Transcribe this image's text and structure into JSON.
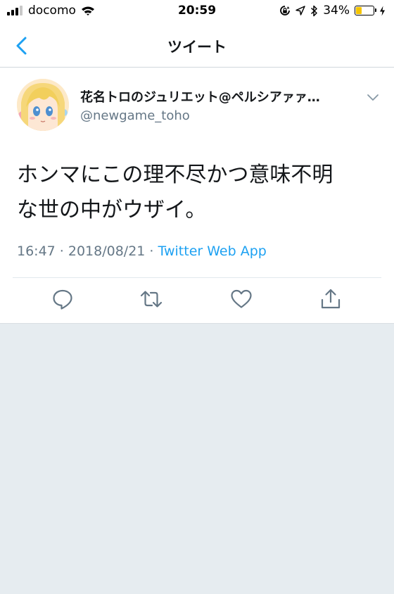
{
  "status_bar": {
    "carrier": "docomo",
    "time": "20:59",
    "battery_percent": "34%",
    "battery_level": 0.34,
    "icons": [
      "signal-icon",
      "wifi-icon",
      "screen-lock-icon",
      "location-icon",
      "bluetooth-icon",
      "battery-icon",
      "charging-icon"
    ]
  },
  "nav": {
    "title": "ツイート",
    "back_icon": "chevron-left-icon"
  },
  "tweet": {
    "display_name": "花名トロのジュリエット@ペルシアァァ…",
    "handle": "@newgame_toho",
    "text_line1": "ホンマにこの理不尽かつ意味不明",
    "text_line2": "な世の中がウザイ。",
    "timestamp": "16:47 · 2018/08/21 · ",
    "source": "Twitter Web App",
    "actions": [
      "reply-icon",
      "retweet-icon",
      "like-icon",
      "share-icon"
    ]
  },
  "colors": {
    "accent": "#1da1f2",
    "secondary_text": "#657786",
    "background": "#e6ecf0",
    "battery_fill": "#f5c400"
  }
}
